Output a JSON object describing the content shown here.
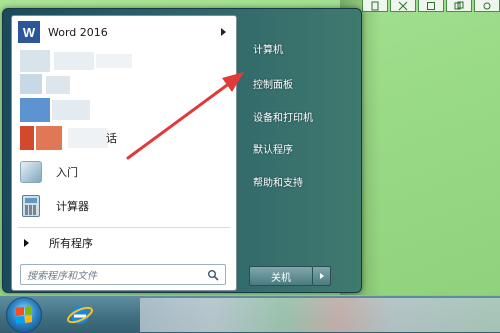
{
  "menu": {
    "pinned": [
      {
        "label": "Word 2016",
        "icon": "word-icon",
        "has_submenu": true
      }
    ],
    "obscured_item_fragment": "话",
    "recent": [
      {
        "label": "入门",
        "icon": "getting-started-icon"
      },
      {
        "label": "计算器",
        "icon": "calculator-icon"
      }
    ],
    "all_programs": "所有程序",
    "search_placeholder": "搜索程序和文件"
  },
  "right_pane": {
    "items": [
      "计算机",
      "控制面板",
      "设备和打印机",
      "默认程序",
      "帮助和支持"
    ]
  },
  "shutdown": {
    "label": "关机"
  },
  "colors": {
    "annotation_arrow": "#e03a3a",
    "desktop": "#9fd98a",
    "taskbar": "#4a7b8c"
  }
}
